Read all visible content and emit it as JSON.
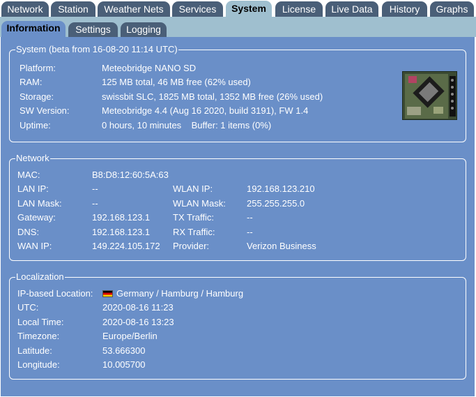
{
  "top_tabs": [
    {
      "label": "Network",
      "active": false
    },
    {
      "label": "Station",
      "active": false
    },
    {
      "label": "Weather Nets",
      "active": false
    },
    {
      "label": "Services",
      "active": false
    },
    {
      "label": "System",
      "active": true
    },
    {
      "label": "License",
      "active": false
    },
    {
      "label": "Live Data",
      "active": false
    },
    {
      "label": "History",
      "active": false
    },
    {
      "label": "Graphs",
      "active": false
    }
  ],
  "sub_tabs": [
    {
      "label": "Information",
      "active": true
    },
    {
      "label": "Settings",
      "active": false
    },
    {
      "label": "Logging",
      "active": false
    }
  ],
  "system": {
    "legend": "System (beta from 16-08-20 11:14 UTC)",
    "rows": [
      {
        "label": "Platform:",
        "value": "Meteobridge NANO SD"
      },
      {
        "label": "RAM:",
        "value": "125 MB total, 46 MB free (62% used)"
      },
      {
        "label": "Storage:",
        "value": "swissbit SLC, 1825 MB total, 1352 MB free (26% used)"
      },
      {
        "label": "SW Version:",
        "value": "Meteobridge 4.4 (Aug 16 2020, build 3191), FW 1.4"
      },
      {
        "label": "Uptime:",
        "value": "0 hours, 10 minutes    Buffer: 1 items (0%)"
      }
    ]
  },
  "network": {
    "legend": "Network",
    "mac_label": "MAC:",
    "mac_value": "B8:D8:12:60:5A:63",
    "rows": [
      {
        "label": "LAN IP:",
        "value": "--",
        "label2": "WLAN IP:",
        "value2": "192.168.123.210"
      },
      {
        "label": "LAN Mask:",
        "value": "--",
        "label2": "WLAN Mask:",
        "value2": "255.255.255.0"
      },
      {
        "label": "Gateway:",
        "value": "192.168.123.1",
        "label2": "TX Traffic:",
        "value2": "--"
      },
      {
        "label": "DNS:",
        "value": "192.168.123.1",
        "label2": "RX Traffic:",
        "value2": "--"
      },
      {
        "label": "WAN IP:",
        "value": "149.224.105.172",
        "label2": "Provider:",
        "value2": "Verizon Business"
      }
    ]
  },
  "localization": {
    "legend": "Localization",
    "rows": [
      {
        "label": "IP-based Location:",
        "value": "Germany / Hamburg / Hamburg",
        "flag": true
      },
      {
        "label": "UTC:",
        "value": "2020-08-16 11:23"
      },
      {
        "label": "Local Time:",
        "value": "2020-08-16 13:23"
      },
      {
        "label": "Timezone:",
        "value": "Europe/Berlin"
      },
      {
        "label": "Latitude:",
        "value": "53.666300"
      },
      {
        "label": "Longitude:",
        "value": "10.005700"
      }
    ]
  },
  "colors": {
    "tab_bg": "#4a5f78",
    "sub_bar_bg": "#9fbfcf",
    "content_bg": "#6a8fc8"
  }
}
